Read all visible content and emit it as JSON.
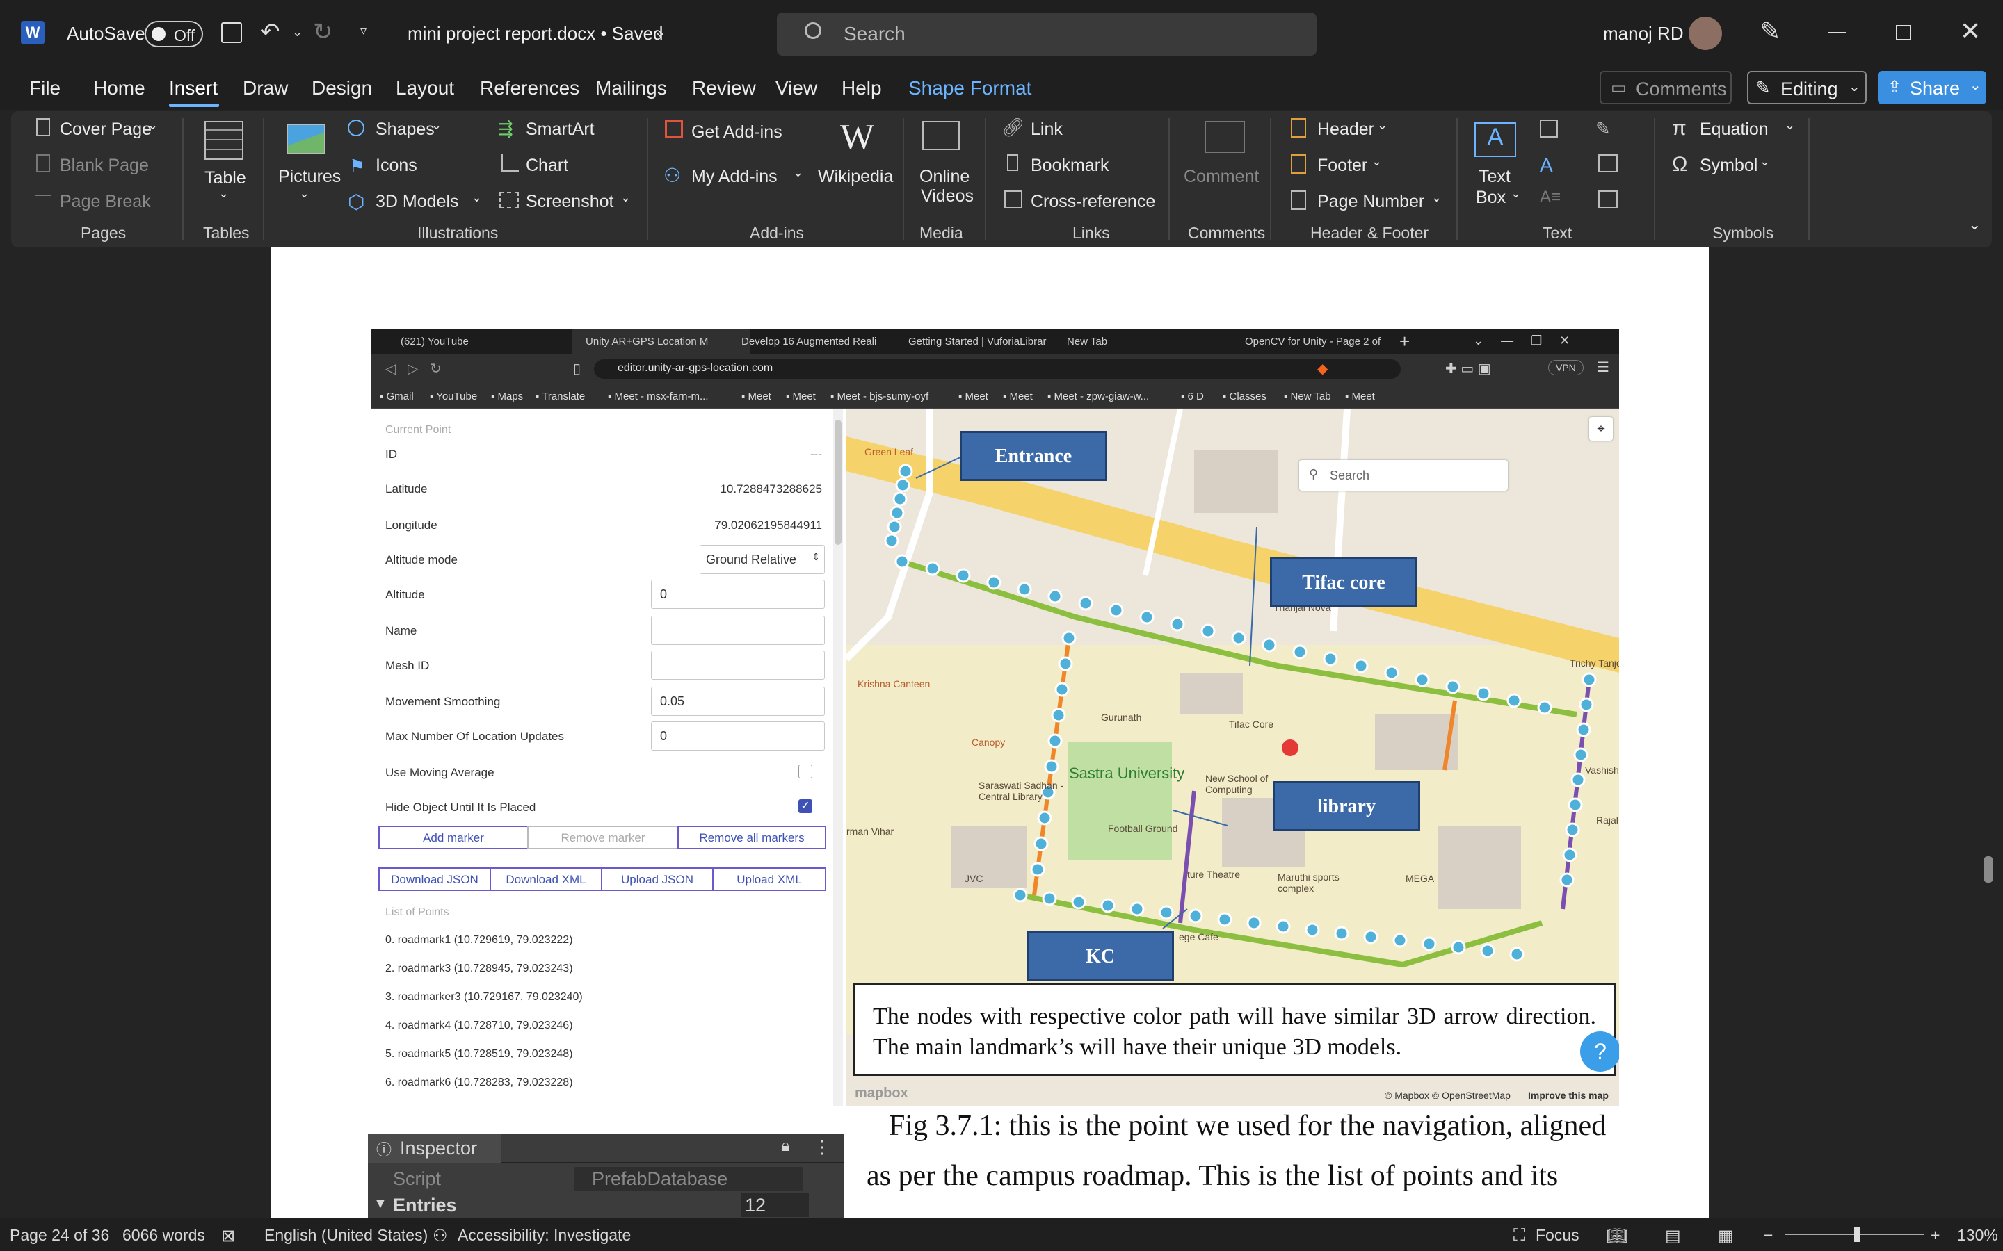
{
  "titlebar": {
    "autosave_label": "AutoSave",
    "autosave_state": "Off",
    "doc_title": "mini project report.docx • Saved",
    "search_placeholder": "Search",
    "user_name": "manoj RD"
  },
  "menu": {
    "tabs": [
      "File",
      "Home",
      "Insert",
      "Draw",
      "Design",
      "Layout",
      "References",
      "Mailings",
      "Review",
      "View",
      "Help",
      "Shape Format"
    ],
    "active_tab": "Insert",
    "comments_label": "Comments",
    "editing_label": "Editing",
    "share_label": "Share"
  },
  "ribbon": {
    "pages": {
      "cover": "Cover Page",
      "blank": "Blank Page",
      "break": "Page Break",
      "group": "Pages"
    },
    "tables": {
      "table": "Table",
      "group": "Tables"
    },
    "illustrations": {
      "pictures": "Pictures",
      "shapes": "Shapes",
      "icons": "Icons",
      "models": "3D Models",
      "smartart": "SmartArt",
      "chart": "Chart",
      "screenshot": "Screenshot",
      "group": "Illustrations"
    },
    "addins": {
      "get": "Get Add-ins",
      "my": "My Add-ins",
      "wiki": "Wikipedia",
      "group": "Add-ins"
    },
    "media": {
      "online": "Online",
      "videos": "Videos",
      "group": "Media"
    },
    "links": {
      "link": "Link",
      "bookmark": "Bookmark",
      "crossref": "Cross-reference",
      "group": "Links"
    },
    "comments": {
      "comment": "Comment",
      "group": "Comments"
    },
    "headerfooter": {
      "header": "Header",
      "footer": "Footer",
      "pagenum": "Page Number",
      "group": "Header & Footer"
    },
    "text": {
      "textbox_1": "Text",
      "textbox_2": "Box",
      "group": "Text"
    },
    "symbols": {
      "equation": "Equation",
      "symbol": "Symbol",
      "group": "Symbols"
    }
  },
  "screenshot": {
    "tabs": [
      "(621) YouTube",
      "Unity AR+GPS Location M",
      "Develop 16 Augmented Reali",
      "Getting Started | VuforiaLibrar",
      "New Tab",
      "OpenCV for Unity - Page 2 of"
    ],
    "url": "editor.unity-ar-gps-location.com",
    "vpn": "VPN",
    "bookmarks": [
      "Gmail",
      "YouTube",
      "Maps",
      "Translate",
      "Meet - msx-farn-m...",
      "Meet",
      "Meet",
      "Meet - bjs-sumy-oyf",
      "Meet",
      "Meet",
      "Meet - zpw-giaw-w...",
      "6 D",
      "Classes",
      "New Tab",
      "Meet"
    ],
    "panel": {
      "section": "Current Point",
      "id_label": "ID",
      "id_value": "---",
      "lat_label": "Latitude",
      "lat_value": "10.7288473288625",
      "lon_label": "Longitude",
      "lon_value": "79.02062195844911",
      "alt_mode_label": "Altitude mode",
      "alt_mode_value": "Ground Relative",
      "alt_label": "Altitude",
      "alt_value": "0",
      "name_label": "Name",
      "name_value": "",
      "mesh_label": "Mesh ID",
      "mesh_value": "",
      "smooth_label": "Movement Smoothing",
      "smooth_value": "0.05",
      "maxloc_label": "Max Number Of Location Updates",
      "maxloc_value": "0",
      "moving_avg_label": "Use Moving Average",
      "hide_label": "Hide Object Until It Is Placed",
      "add_marker": "Add marker",
      "remove_marker": "Remove marker",
      "remove_all": "Remove all markers",
      "dl_json": "Download JSON",
      "dl_xml": "Download XML",
      "ul_json": "Upload JSON",
      "ul_xml": "Upload XML",
      "list_header": "List of Points",
      "points": [
        "0. roadmark1 (10.729619, 79.023222)",
        "2. roadmark3 (10.728945, 79.023243)",
        "3. roadmarker3 (10.729167, 79.023240)",
        "4. roadmark4 (10.728710, 79.023246)",
        "5. roadmark5 (10.728519, 79.023248)",
        "6. roadmark6 (10.728283, 79.023228)"
      ]
    },
    "map": {
      "search_placeholder": "Search",
      "labels": [
        "Green Leaf",
        "Thanjai Nova",
        "Trichy Tanjore",
        "Krishna Canteen",
        "Gurunath",
        "Tifac Core",
        "Canopy",
        "Sastra University",
        "Saraswati Sadhan - Central Library",
        "New School of Computing",
        "Football Ground",
        "rman Vihar",
        "JVC",
        "Maruthi sports complex",
        "MEGA",
        "Rajal",
        "Vashishta",
        "ege Cafe",
        "ture Theatre"
      ],
      "callouts": {
        "entrance": "Entrance",
        "tifac": "Tifac core",
        "library": "library",
        "kc": "KC"
      },
      "caption": "The nodes with respective color path will have similar 3D arrow direction. The main landmark’s will have their unique 3D models.",
      "attribution": "© Mapbox © OpenStreetMap",
      "improve": "Improve this map",
      "logo": "mapbox"
    }
  },
  "body": {
    "line1": "Fig 3.7.1: this is the point we used for the navigation, aligned",
    "line2": "as per the campus roadmap. This is the list of points and its"
  },
  "unity": {
    "title": "Inspector",
    "script_label": "Script",
    "script_value": "PrefabDatabase",
    "entries_label": "Entries",
    "entries_value": "12"
  },
  "status": {
    "page": "Page 24 of 36",
    "words": "6066 words",
    "language": "English (United States)",
    "accessibility": "Accessibility: Investigate",
    "focus": "Focus",
    "zoom": "130%"
  },
  "colors": {
    "accent": "#6cb4ff",
    "callout": "#3c6aa8",
    "path_green": "#8cbf3f",
    "path_orange": "#f0862a",
    "path_purple": "#7a4fb0",
    "marker": "#4fb0d8"
  }
}
